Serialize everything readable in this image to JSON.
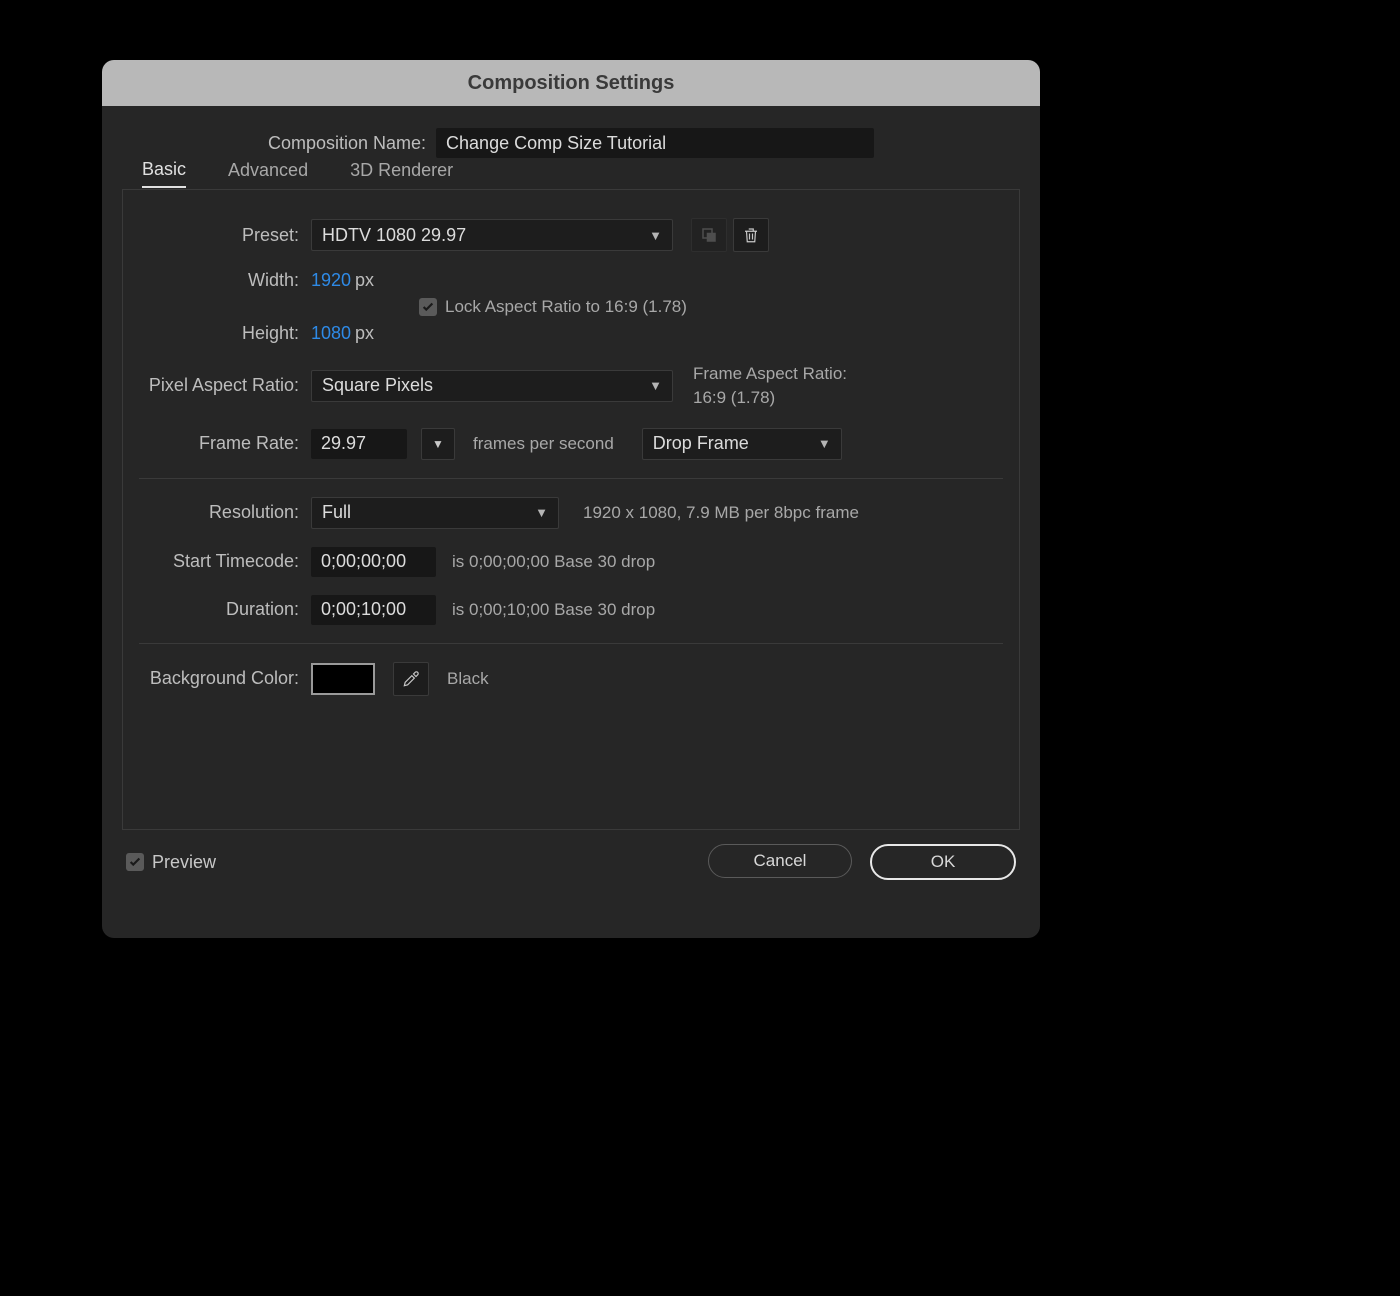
{
  "dialog": {
    "title": "Composition Settings",
    "name_label": "Composition Name:",
    "name_value": "Change Comp Size Tutorial",
    "tabs": [
      "Basic",
      "Advanced",
      "3D Renderer"
    ],
    "active_tab": "Basic"
  },
  "basic": {
    "preset_label": "Preset:",
    "preset_value": "HDTV 1080 29.97",
    "width_label": "Width:",
    "width_value": "1920",
    "height_label": "Height:",
    "height_value": "1080",
    "px_unit": "px",
    "lock_aspect_checked": true,
    "lock_aspect_label": "Lock Aspect Ratio to 16:9 (1.78)",
    "par_label": "Pixel Aspect Ratio:",
    "par_value": "Square Pixels",
    "far_label": "Frame Aspect Ratio:",
    "far_value": "16:9 (1.78)",
    "framerate_label": "Frame Rate:",
    "framerate_value": "29.97",
    "fps_text": "frames per second",
    "dropframe_value": "Drop Frame",
    "resolution_label": "Resolution:",
    "resolution_value": "Full",
    "resolution_info": "1920 x 1080, 7.9 MB per 8bpc frame",
    "start_tc_label": "Start Timecode:",
    "start_tc_value": "0;00;00;00",
    "start_tc_info": "is 0;00;00;00  Base 30  drop",
    "duration_label": "Duration:",
    "duration_value": "0;00;10;00",
    "duration_info": "is 0;00;10;00  Base 30  drop",
    "bg_label": "Background Color:",
    "bg_color_hex": "#000000",
    "bg_name": "Black"
  },
  "footer": {
    "preview_checked": true,
    "preview_label": "Preview",
    "cancel_label": "Cancel",
    "ok_label": "OK"
  }
}
